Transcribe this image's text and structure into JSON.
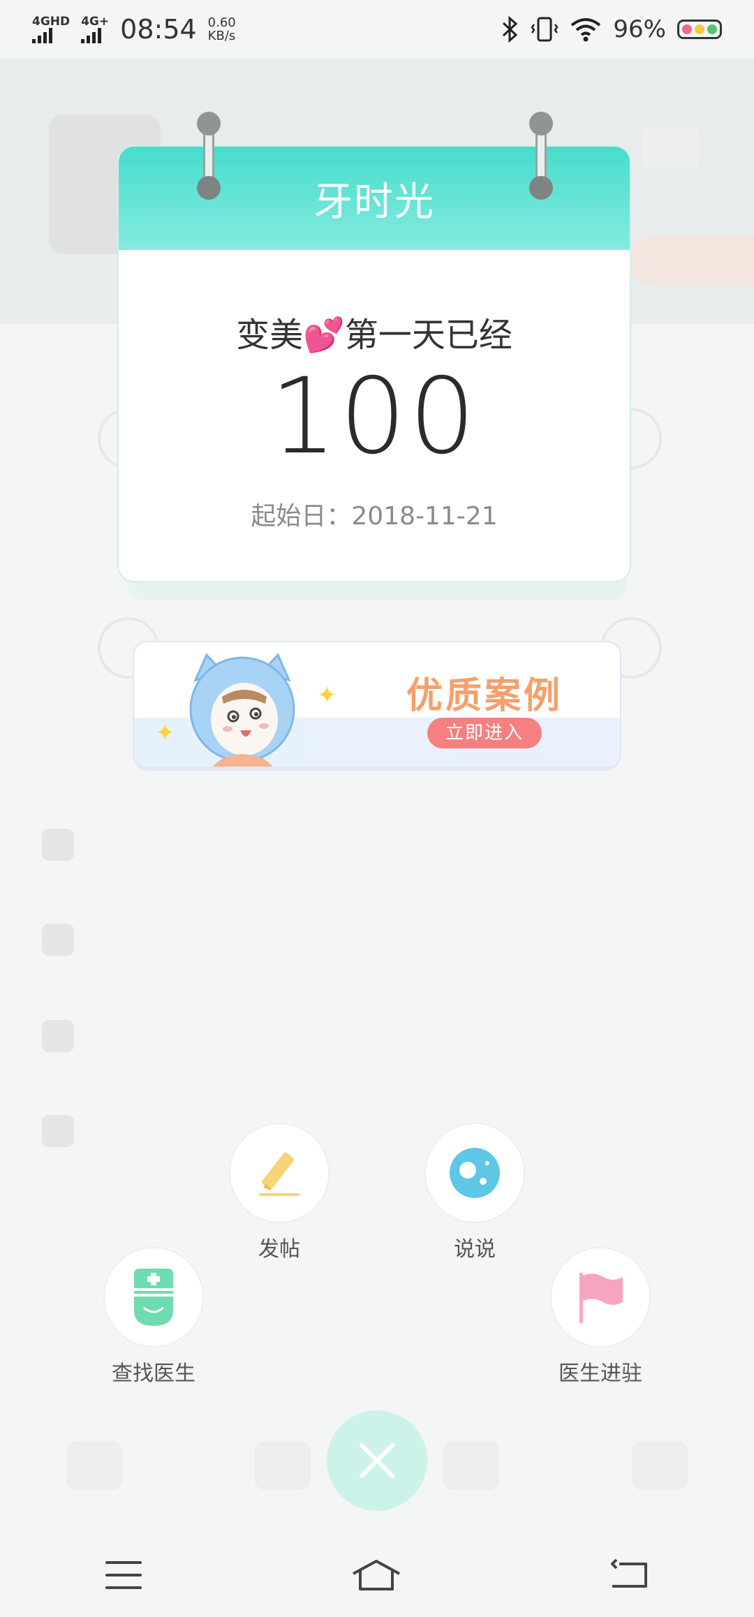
{
  "status_bar": {
    "network1": "4GHD",
    "network2": "4G+",
    "time": "08:54",
    "speed_value": "0.60",
    "speed_unit": "KB/s",
    "battery_percent": "96%"
  },
  "calendar": {
    "title": "牙时光",
    "caption_before": "变美",
    "caption_heart": "💕",
    "caption_after": "第一天已经",
    "day_count": "100",
    "start_date": "起始日：2018-11-21"
  },
  "banner": {
    "title": "优质案例",
    "button": "立即进入"
  },
  "actions": {
    "post": "发帖",
    "moments": "说说",
    "find_doctor": "查找医生",
    "doctor_join": "医生进驻"
  },
  "colors": {
    "accent": "#46ddcc",
    "pencil": "#f9d37a",
    "planet": "#5fc7e6",
    "doctor": "#6fdcb0",
    "flag": "#f7a4c3",
    "banner_text": "#f4a06c",
    "banner_button": "#f58080"
  }
}
